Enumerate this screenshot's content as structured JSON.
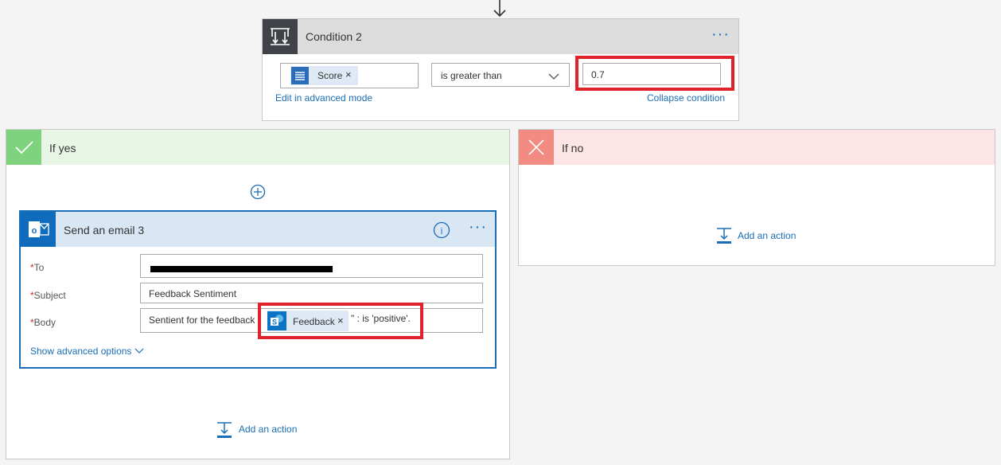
{
  "condition": {
    "title": "Condition 2",
    "more_label": "···",
    "left_operand_token": "Score",
    "token_remove": "×",
    "operator": "is greater than",
    "value": "0.7",
    "edit_advanced_link": "Edit in advanced mode",
    "collapse_link": "Collapse condition"
  },
  "if_yes": {
    "title": "If yes",
    "add_action_label": "Add an action",
    "email_action": {
      "title": "Send an email 3",
      "info_label": "i",
      "more_label": "···",
      "required_marker": "*",
      "fields": {
        "to_label": "To",
        "subject_label": "Subject",
        "subject_value": "Feedback Sentiment",
        "body_label": "Body",
        "body_prefix": "Sentient for the feedback",
        "body_token": "Feedback",
        "body_suffix": "\" : is 'positive'."
      },
      "show_advanced_label": "Show advanced options"
    }
  },
  "if_no": {
    "title": "If no",
    "add_action_label": "Add an action"
  },
  "colors": {
    "accent_blue": "#1a6eb6",
    "highlight_red": "#e0232a",
    "yes_green": "#7fd37f",
    "no_red": "#f28b82",
    "condition_dark": "#3f4348"
  }
}
